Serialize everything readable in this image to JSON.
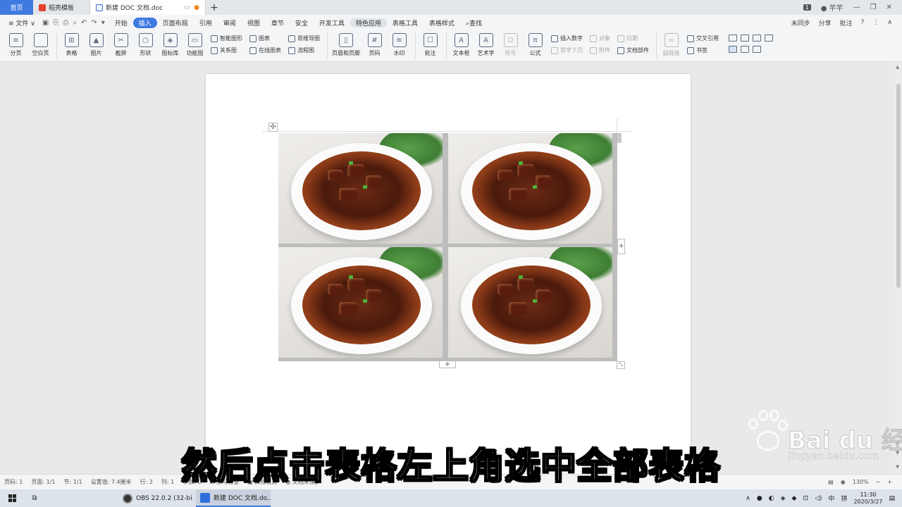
{
  "tabs": {
    "home": "首页",
    "template": "稻壳模板",
    "document": "新建 DOC 文档.doc",
    "new_tab": "+"
  },
  "window": {
    "badge": "1",
    "user": "芊芊",
    "min": "—",
    "restore": "❐",
    "close": "✕"
  },
  "menu": {
    "file": "≡ 文件 ∨",
    "items": [
      "开始",
      "插入",
      "页面布局",
      "引用",
      "审阅",
      "视图",
      "章节",
      "安全",
      "开发工具",
      "特色应用",
      "表格工具",
      "表格样式"
    ],
    "active": "插入",
    "hover": "特色应用",
    "search": "查找",
    "right": [
      "未同步",
      "分享",
      "批注",
      "?",
      "⋮",
      "∧"
    ]
  },
  "ribbon": {
    "page_break": "分页",
    "blank_page": "空白页",
    "table": "表格",
    "picture": "图片",
    "screenshot": "截屏",
    "shapes": "形状",
    "icon_lib": "图标库",
    "func_chart": "功能图",
    "smart_art": "智能图形",
    "relation": "关系图",
    "chart": "图表",
    "online_chart": "在线图表",
    "mind_map": "思维导图",
    "flowchart": "流程图",
    "header_footer": "页眉和页脚",
    "page_number": "页码",
    "watermark": "水印",
    "comment": "批注",
    "textbox": "文本框",
    "wordart": "艺术字",
    "symbol": "符号",
    "formula": "公式",
    "insert_number": "插入数字",
    "object": "对象",
    "date": "日期",
    "dropcap": "首字下沉",
    "attachment": "附件",
    "doc_parts": "文档部件",
    "hyperlink": "超链接",
    "cross_ref": "交叉引用",
    "bookmark": "书签"
  },
  "subtitle": "然后点击表格左上角选中全部表格",
  "watermark_text": {
    "brand": "Bai du 经验",
    "url": "jingyan.baidu.com"
  },
  "status": {
    "page": "页码: 1",
    "pages": "页面: 1/1",
    "section": "节: 1/1",
    "setting": "设置值: 7.4厘米",
    "row": "行: 2",
    "col": "列: 1",
    "words": "字数: 0",
    "spell": "拼写检查",
    "proof": "文档校对",
    "protect": "文档未保护",
    "zoom": "130%"
  },
  "taskbar": {
    "obs": "OBS 22.0.2 (32-bi...",
    "wps": "新建 DOC 文档.do...",
    "ime": "中",
    "layout": "拼",
    "time": "11:30",
    "date": "2020/3/27"
  },
  "colors": {
    "accent": "#3e7ae0",
    "page": "#ffffff",
    "canvas": "#e9e9e9"
  }
}
